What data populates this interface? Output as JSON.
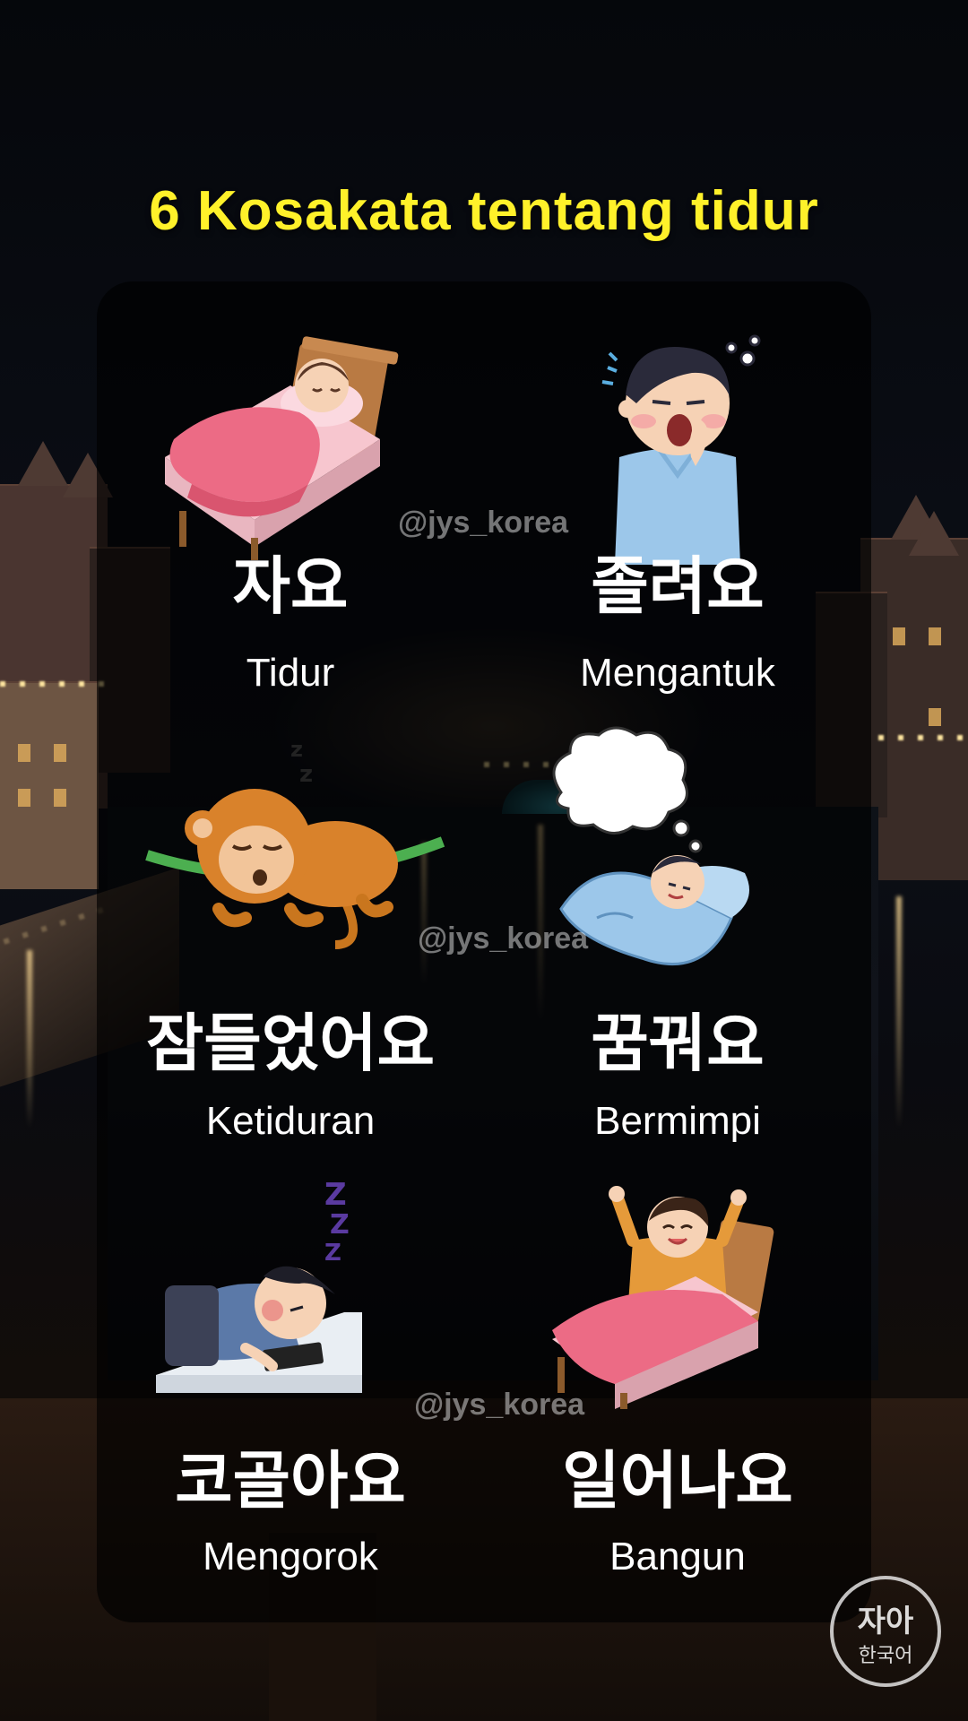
{
  "title": "6 Kosakata tentang tidur",
  "watermark": "@jys_korea",
  "logo_text": "자아한국어",
  "accent_color": "#fff12a",
  "items": [
    {
      "ko": "자요",
      "id": "Tidur",
      "icon": "sleeping-in-bed-icon"
    },
    {
      "ko": "졸려요",
      "id": "Mengantuk",
      "icon": "yawning-person-icon"
    },
    {
      "ko": "잠들었어요",
      "id": "Ketiduran",
      "icon": "sleeping-monkey-icon"
    },
    {
      "ko": "꿈꿔요",
      "id": "Bermimpi",
      "icon": "dreaming-child-icon"
    },
    {
      "ko": "코골아요",
      "id": "Mengorok",
      "icon": "snoring-at-desk-icon"
    },
    {
      "ko": "일어나요",
      "id": "Bangun",
      "icon": "waking-up-icon"
    }
  ]
}
